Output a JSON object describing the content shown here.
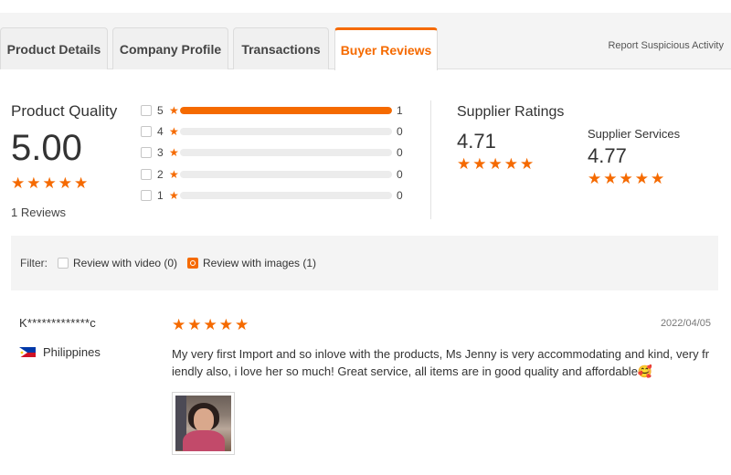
{
  "tabs": [
    {
      "label": "Product Details",
      "active": false
    },
    {
      "label": "Company Profile",
      "active": false
    },
    {
      "label": "Transactions",
      "active": false
    },
    {
      "label": "Buyer Reviews",
      "active": true
    }
  ],
  "report_link": "Report Suspicious Activity",
  "product_quality": {
    "title": "Product Quality",
    "score": "5.00",
    "stars": 5,
    "review_count": "1 Reviews"
  },
  "rating_breakdown": [
    {
      "stars": "5",
      "count": "1",
      "fraction": 1.0
    },
    {
      "stars": "4",
      "count": "0",
      "fraction": 0.0
    },
    {
      "stars": "3",
      "count": "0",
      "fraction": 0.0
    },
    {
      "stars": "2",
      "count": "0",
      "fraction": 0.0
    },
    {
      "stars": "1",
      "count": "0",
      "fraction": 0.0
    }
  ],
  "supplier_ratings": {
    "title": "Supplier Ratings",
    "score": "4.71",
    "stars": 5
  },
  "supplier_services": {
    "title": "Supplier Services",
    "score": "4.77",
    "stars": 5
  },
  "filter": {
    "label": "Filter:",
    "options": [
      {
        "label": "Review with video (0)",
        "checked": false
      },
      {
        "label": "Review with images (1)",
        "checked": true
      }
    ]
  },
  "review": {
    "reviewer": "K*************c",
    "country": "Philippines",
    "stars": 5,
    "date": "2022/04/05",
    "text": "My very first Import and so inlove with the products, Ms Jenny is very accommodating and kind, very friendly also, i love her so much! Great service, all items are in good quality and affordable🥰"
  },
  "colors": {
    "accent": "#f56a00",
    "bar_track": "#ececec",
    "filter_bg": "#f4f4f4"
  },
  "icons": {
    "star": "star-icon",
    "flag": "philippines-flag-icon"
  }
}
